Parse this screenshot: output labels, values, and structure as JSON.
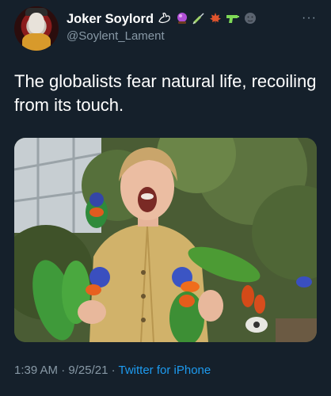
{
  "author": {
    "display_name": "Joker Soylord",
    "handle": "@Soylent_Lament",
    "badges": [
      "goose-emoji",
      "crystal-ball-emoji",
      "syringe-emoji",
      "maple-leaf-emoji",
      "water-pistol-emoji",
      "new-moon-face-emoji"
    ]
  },
  "tweet": {
    "text": "The globalists fear natural life, recoiling from its touch."
  },
  "footer": {
    "time": "1:39 AM",
    "sep1": " · ",
    "date": "9/25/21",
    "sep2": " · ",
    "source": "Twitter for iPhone"
  },
  "menu": {
    "more_label": "···"
  },
  "colors": {
    "background": "#15202b",
    "secondary_text": "#8899a6",
    "link": "#1d9bf0"
  }
}
